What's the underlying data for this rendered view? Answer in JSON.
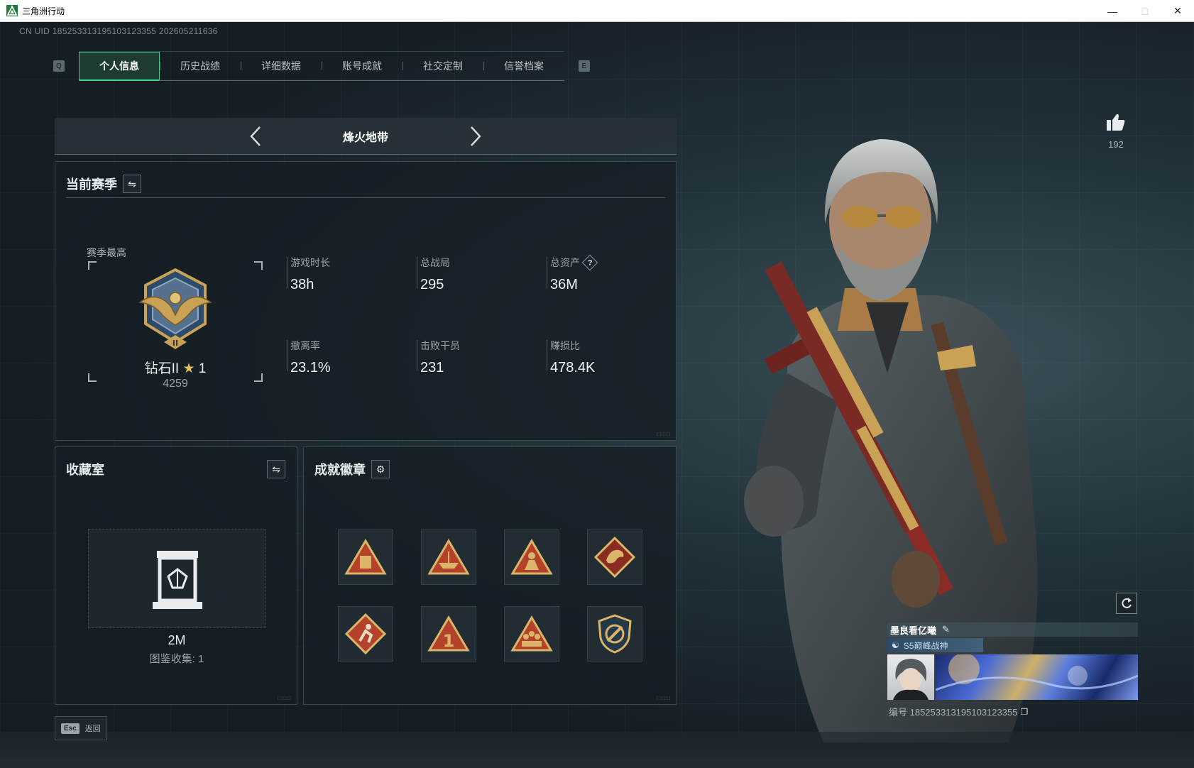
{
  "window": {
    "title": "三角洲行动",
    "minimize_icon": "minimize-icon",
    "maximize_icon": "maximize-icon",
    "close_icon": "close-icon"
  },
  "uid_line": "CN UID 185253313195103123355 202605211636",
  "tabs": {
    "left_key": "Q",
    "right_key": "E",
    "items": [
      {
        "label": "个人信息",
        "active": true
      },
      {
        "label": "历史战绩",
        "active": false
      },
      {
        "label": "详细数据",
        "active": false
      },
      {
        "label": "账号成就",
        "active": false
      },
      {
        "label": "社交定制",
        "active": false
      },
      {
        "label": "信誉档案",
        "active": false
      }
    ]
  },
  "mode": {
    "title": "烽火地带"
  },
  "season": {
    "title": "当前赛季",
    "best_label": "赛季最高",
    "rank_name": "钻石II",
    "rank_stars": "1",
    "rank_score": "4259",
    "stats": [
      {
        "label": "游戏时长",
        "value": "38h"
      },
      {
        "label": "总战局",
        "value": "295"
      },
      {
        "label": "总资产",
        "value": "36M",
        "help": "?"
      },
      {
        "label": "撤离率",
        "value": "23.1%"
      },
      {
        "label": "击败干员",
        "value": "231"
      },
      {
        "label": "赚损比",
        "value": "478.4K"
      }
    ]
  },
  "collection": {
    "title": "收藏室",
    "value": "2M",
    "count_text": "图鉴收集: 1"
  },
  "badges": {
    "title": "成就徽章",
    "items": [
      {
        "icon": "triangle-crate-badge-icon"
      },
      {
        "icon": "triangle-ship-badge-icon"
      },
      {
        "icon": "triangle-soldier-badge-icon"
      },
      {
        "icon": "dragon-badge-icon"
      },
      {
        "icon": "diamond-runner-badge-icon"
      },
      {
        "icon": "triangle-number-one-badge-icon"
      },
      {
        "icon": "triangle-squad-badge-icon"
      },
      {
        "icon": "shield-wrench-badge-icon"
      }
    ]
  },
  "profile": {
    "likes": "192",
    "nickname": "墨良看亿曦",
    "title_badge": "S5巅峰战神",
    "id_text": "编号 185253313195103123355"
  },
  "footer": {
    "esc_key": "Esc",
    "back_label": "返回"
  },
  "colors": {
    "accent": "#3fd894",
    "gold": "#c9a256",
    "panel_bg": "#141e23"
  }
}
